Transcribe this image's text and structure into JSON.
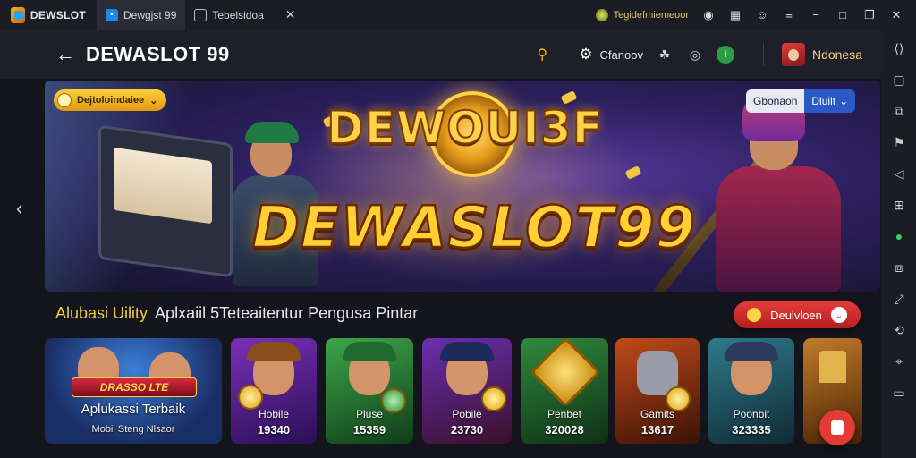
{
  "window": {
    "brand": "DEWSLOT",
    "tabs": [
      {
        "label": "Dewgjst 99",
        "icon": "app-icon",
        "active": true
      },
      {
        "label": "Tebelsidoa",
        "icon": "screen-icon",
        "active": false
      }
    ],
    "notification": "Tegidefmiemeoor"
  },
  "header": {
    "title": "DEWASLOT 99",
    "setting_label": "Cfanoov",
    "user_name": "Ndonesa"
  },
  "banner": {
    "logo_top": "DEWOUI3F",
    "logo_main": "DEWASLOT99",
    "badge_left": "Dejtoloindaiee",
    "badge_right_a": "Gbonaon",
    "badge_right_b": "Dluilt"
  },
  "section": {
    "title_highlight": "Alubasi Uility",
    "title_rest": "Aplxaiil 5Teteaitentur Pengusa Pintar",
    "download_label": "Deulvloen"
  },
  "featured_card": {
    "tag": "DRASSO LTE",
    "title": "Aplukassi Terbaik",
    "subtitle": "Mobil Steng Nlsaor"
  },
  "cards": [
    {
      "label": "Hobile",
      "count": "19340"
    },
    {
      "label": "Pluse",
      "count": "15359"
    },
    {
      "label": "Pobile",
      "count": "23730"
    },
    {
      "label": "Penbet",
      "count": "320028"
    },
    {
      "label": "Gamits",
      "count": "13617"
    },
    {
      "label": "Poonbit",
      "count": "323335"
    }
  ],
  "colors": {
    "accent_gold": "#f3cc3c",
    "download_red": "#e53b3b",
    "header_bg": "#1d1f29"
  }
}
